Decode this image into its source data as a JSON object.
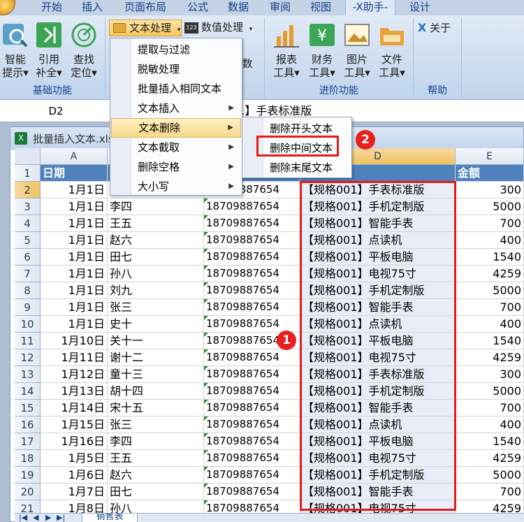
{
  "ribbon_tabs": [
    "开始",
    "插入",
    "页面布局",
    "公式",
    "数据",
    "审阅",
    "视图",
    "-X助手-",
    "设计"
  ],
  "ribbon": {
    "smart_tip": [
      "智能",
      "提示▾"
    ],
    "ref_fill": [
      "引用",
      "补全▾"
    ],
    "find_locate": [
      "查找",
      "定位▾"
    ],
    "basic_group": "基础功能",
    "text_process": "文本处理",
    "value_process": "数值处理",
    "shu": "数",
    "report_tool": [
      "报表",
      "工具▾"
    ],
    "finance_tool": [
      "财务",
      "工具▾"
    ],
    "image_tool": [
      "图片",
      "工具▾"
    ],
    "file_tool": [
      "文件",
      "工具▾"
    ],
    "advanced_group": "进阶功能",
    "about": "关于",
    "help_group": "帮助"
  },
  "formula_bar": {
    "cell": "D2",
    "content": "01】手表标准版"
  },
  "workbook_title": "批量插入文本.xls",
  "menu1": {
    "items": [
      "提取与过滤",
      "脱敏处理",
      "批量插入相同文本",
      "文本插入",
      "文本删除",
      "文本截取",
      "删除空格",
      "大小写"
    ]
  },
  "menu2": {
    "items": [
      "删除开头文本",
      "删除中间文本",
      "删除末尾文本"
    ]
  },
  "badges": [
    "1",
    "2"
  ],
  "columns": [
    "A",
    "B",
    "C",
    "D",
    "E"
  ],
  "header_row": {
    "date": "日期",
    "name": "",
    "phone": "",
    "product": "产品",
    "amount": "金额"
  },
  "rows": [
    {
      "n": "2",
      "date": "1月1日",
      "name": "",
      "phone": "18709887654",
      "product": "【规格001】手表标准版",
      "amount": "300"
    },
    {
      "n": "3",
      "date": "1月1日",
      "name": "李四",
      "phone": "18709887654",
      "product": "【规格001】手机定制版",
      "amount": "5000"
    },
    {
      "n": "4",
      "date": "1月1日",
      "name": "王五",
      "phone": "18709887654",
      "product": "【规格001】智能手表",
      "amount": "700"
    },
    {
      "n": "5",
      "date": "1月1日",
      "name": "赵六",
      "phone": "18709887654",
      "product": "【规格001】点读机",
      "amount": "400"
    },
    {
      "n": "6",
      "date": "1月1日",
      "name": "田七",
      "phone": "18709887654",
      "product": "【规格001】平板电脑",
      "amount": "1540"
    },
    {
      "n": "7",
      "date": "1月1日",
      "name": "孙八",
      "phone": "18709887654",
      "product": "【规格001】电视75寸",
      "amount": "4259"
    },
    {
      "n": "8",
      "date": "1月1日",
      "name": "刘九",
      "phone": "18709887654",
      "product": "【规格001】手机定制版",
      "amount": "5000"
    },
    {
      "n": "9",
      "date": "1月1日",
      "name": "张三",
      "phone": "18709887654",
      "product": "【规格001】智能手表",
      "amount": "700"
    },
    {
      "n": "10",
      "date": "1月1日",
      "name": "史十",
      "phone": "18709887654",
      "product": "【规格001】点读机",
      "amount": "400"
    },
    {
      "n": "11",
      "date": "1月10日",
      "name": "关十一",
      "phone": "18709887654",
      "product": "【规格001】平板电脑",
      "amount": "1540"
    },
    {
      "n": "12",
      "date": "1月11日",
      "name": "谢十二",
      "phone": "18709887654",
      "product": "【规格001】电视75寸",
      "amount": "4259"
    },
    {
      "n": "13",
      "date": "1月12日",
      "name": "童十三",
      "phone": "18709887654",
      "product": "【规格001】手表标准版",
      "amount": "300"
    },
    {
      "n": "14",
      "date": "1月13日",
      "name": "胡十四",
      "phone": "18709887654",
      "product": "【规格001】手机定制版",
      "amount": "5000"
    },
    {
      "n": "15",
      "date": "1月14日",
      "name": "宋十五",
      "phone": "18709887654",
      "product": "【规格001】智能手表",
      "amount": "700"
    },
    {
      "n": "16",
      "date": "1月15日",
      "name": "张三",
      "phone": "18709887654",
      "product": "【规格001】点读机",
      "amount": "400"
    },
    {
      "n": "17",
      "date": "1月16日",
      "name": "李四",
      "phone": "18709887654",
      "product": "【规格001】平板电脑",
      "amount": "1540"
    },
    {
      "n": "18",
      "date": "1月5日",
      "name": "王五",
      "phone": "18709887654",
      "product": "【规格001】电视75寸",
      "amount": "4259"
    },
    {
      "n": "19",
      "date": "1月6日",
      "name": "赵六",
      "phone": "18709887654",
      "product": "【规格001】手机定制版",
      "amount": "5000"
    },
    {
      "n": "20",
      "date": "1月7日",
      "name": "田七",
      "phone": "18709887654",
      "product": "【规格001】智能手表",
      "amount": "700"
    },
    {
      "n": "21",
      "date": "1月8日",
      "name": "孙八",
      "phone": "18709887654",
      "product": "【规格001】电视75寸",
      "amount": "4259"
    }
  ],
  "sheet_tab": "销售表"
}
